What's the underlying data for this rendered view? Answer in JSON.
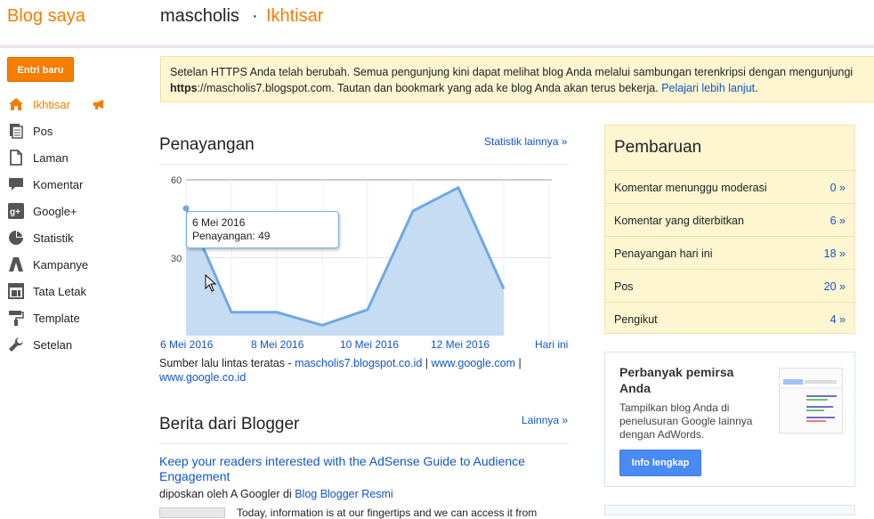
{
  "header": {
    "brand": "Blog saya",
    "blog_name": "mascholis",
    "separator": "·",
    "page": "Ikhtisar"
  },
  "sidebar": {
    "new_post": "Entri baru",
    "items": [
      {
        "label": "Ikhtisar",
        "icon": "home-icon",
        "active": true
      },
      {
        "label": "Pos",
        "icon": "posts-icon"
      },
      {
        "label": "Laman",
        "icon": "pages-icon"
      },
      {
        "label": "Komentar",
        "icon": "comment-icon"
      },
      {
        "label": "Google+",
        "icon": "google-plus-icon"
      },
      {
        "label": "Statistik",
        "icon": "pie-chart-icon"
      },
      {
        "label": "Kampanye",
        "icon": "adwords-icon"
      },
      {
        "label": "Tata Letak",
        "icon": "layout-icon"
      },
      {
        "label": "Template",
        "icon": "paint-roller-icon"
      },
      {
        "label": "Setelan",
        "icon": "wrench-icon"
      }
    ]
  },
  "notice": {
    "line1": "Setelan HTTPS Anda telah berubah. Semua pengunjung kini dapat melihat blog Anda melalui sambungan terenkripsi dengan mengunjungi",
    "bold": "https",
    "line2": "://mascholis7.blogspot.com. Tautan dan bookmark yang ada ke blog Anda akan terus bekerja.",
    "link": "Pelajari lebih lanjut",
    "end": "."
  },
  "views": {
    "title": "Penayangan",
    "more_link": "Statistik lainnya »",
    "tooltip_date": "6 Mei 2016",
    "tooltip_value": "Penayangan: 49",
    "sources_label": "Sumber lalu lintas teratas - ",
    "source1": "mascholis7.blogspot.co.id",
    "sep": " | ",
    "source2": "www.google.com",
    "sep2": " |",
    "source3": "www.google.co.id"
  },
  "chart_data": {
    "type": "area",
    "x": [
      "6 Mei 2016",
      "7 Mei 2016",
      "8 Mei 2016",
      "9 Mei 2016",
      "10 Mei 2016",
      "11 Mei 2016",
      "12 Mei 2016",
      "13 Mei 2016",
      "Hari ini"
    ],
    "x_tick_labels": [
      "6 Mei 2016",
      "8 Mei 2016",
      "10 Mei 2016",
      "12 Mei 2016",
      "Hari ini"
    ],
    "series": [
      {
        "values": [
          49,
          9,
          9,
          4,
          10,
          48,
          57,
          18
        ]
      }
    ],
    "ylim": [
      0,
      60
    ],
    "y_ticks": [
      30,
      60
    ],
    "color": "#6fa8e6",
    "fill": "#c6dcf2",
    "grid": true
  },
  "news": {
    "title": "Berita dari Blogger",
    "more_link": "Lainnya »",
    "post_title": "Keep your readers interested with the AdSense Guide to Audience Engagement",
    "byline_prefix": "diposkan oleh A Googler di ",
    "byline_link": "Blog Blogger Resmi",
    "excerpt": "Today, information is at our fingertips and we can access it from"
  },
  "updates": {
    "title": "Pembaruan",
    "rows": [
      {
        "label": "Komentar menunggu moderasi",
        "value": "0 »"
      },
      {
        "label": "Komentar yang diterbitkan",
        "value": "6 »"
      },
      {
        "label": "Penayangan hari ini",
        "value": "18 »"
      },
      {
        "label": "Pos",
        "value": "20 »"
      },
      {
        "label": "Pengikut",
        "value": "4 »"
      }
    ]
  },
  "promo": {
    "title": "Perbanyak pemirsa Anda",
    "text": "Tampilkan blog Anda di penelusuran Google lainnya dengan AdWords.",
    "button": "Info lengkap"
  },
  "colors": {
    "accent": "#f57d00",
    "link": "#1155cc",
    "notice_bg": "#fdf6d0"
  }
}
